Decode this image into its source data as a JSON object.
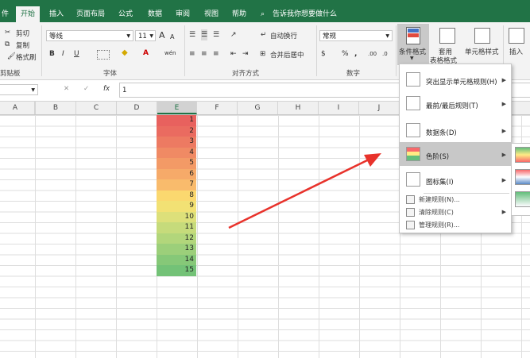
{
  "tabs": [
    "件",
    "开始",
    "插入",
    "页面布局",
    "公式",
    "数据",
    "审阅",
    "视图",
    "帮助"
  ],
  "search_hint": "告诉我你想要做什么",
  "clipboard": {
    "cut": "剪切",
    "copy": "复制",
    "painter": "格式刷",
    "group": "剪贴板"
  },
  "font": {
    "name": "等线",
    "size": "11",
    "grow": "A",
    "shrink": "A",
    "bold": "B",
    "italic": "I",
    "underline": "U",
    "group": "字体"
  },
  "alignment": {
    "wrap": "自动换行",
    "merge": "合并后居中",
    "group": "对齐方式"
  },
  "number": {
    "format": "常规",
    "percent": "%",
    "comma": ",",
    "group": "数字"
  },
  "styles": {
    "cond_format": "条件格式",
    "table_format_1": "套用",
    "table_format_2": "表格格式",
    "cell_style": "单元格样式"
  },
  "cells": {
    "insert": "插入"
  },
  "formula_bar": {
    "fx": "fx",
    "value": "1"
  },
  "columns": [
    "A",
    "B",
    "C",
    "D",
    "E",
    "F",
    "G",
    "H",
    "I",
    "J"
  ],
  "cells_E": [
    "1",
    "2",
    "3",
    "4",
    "5",
    "6",
    "7",
    "8",
    "9",
    "10",
    "11",
    "12",
    "13",
    "14",
    "15"
  ],
  "color_scale": [
    "#e8615e",
    "#ea6b60",
    "#ed7a62",
    "#f08a64",
    "#f39a66",
    "#f6aa69",
    "#f9bb6c",
    "#fbd86f",
    "#f2e174",
    "#dde07a",
    "#c6db7b",
    "#b2d67b",
    "#9ccf7a",
    "#86c878",
    "#73c277"
  ],
  "menu": [
    {
      "label": "突出显示单元格规则(H)",
      "arrow": true
    },
    {
      "label": "最前/最后规则(T)",
      "arrow": true
    },
    {
      "label": "数据条(D)",
      "arrow": true
    },
    {
      "label": "色阶(S)",
      "arrow": true,
      "highlight": true
    },
    {
      "label": "图标集(I)",
      "arrow": true
    }
  ],
  "menu_small": [
    {
      "label": "新建规则(N)...",
      "arrow": false
    },
    {
      "label": "清除规则(C)",
      "arrow": true
    },
    {
      "label": "管理规则(R)...",
      "arrow": false
    }
  ],
  "accent": "#217346",
  "arrow_color": "#e8322b"
}
